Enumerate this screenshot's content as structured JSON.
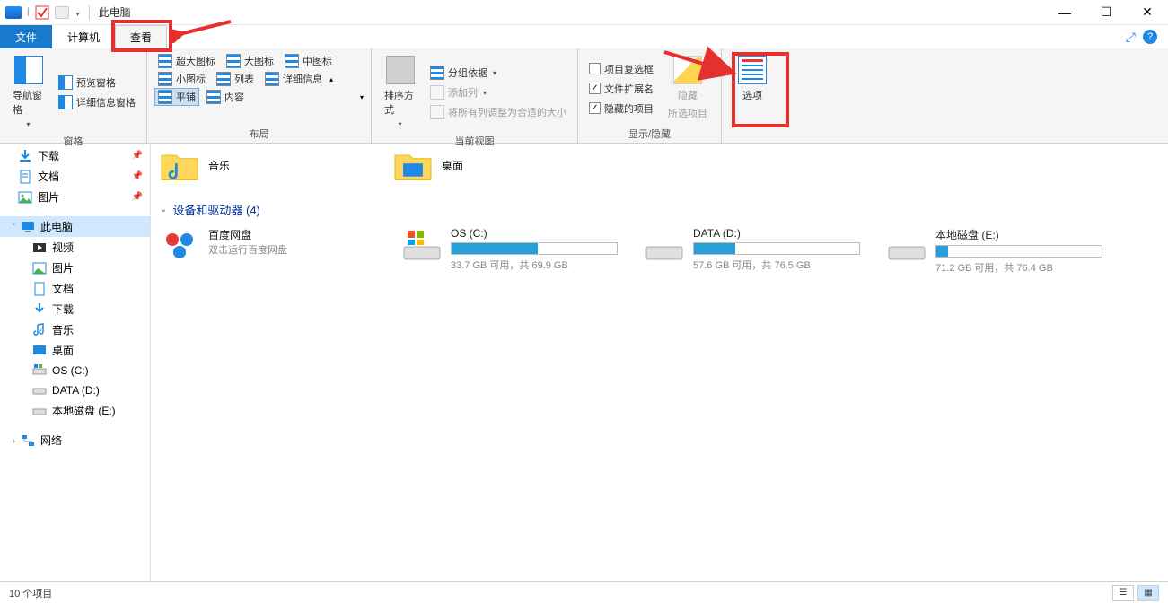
{
  "window": {
    "title": "此电脑"
  },
  "tabs": {
    "file": "文件",
    "computer": "计算机",
    "view": "查看"
  },
  "ribbon": {
    "panes": {
      "nav": "导航窗格",
      "preview": "预览窗格",
      "details": "详细信息窗格",
      "group_label": "窗格"
    },
    "layout": {
      "xl_icons": "超大图标",
      "l_icons": "大图标",
      "m_icons": "中图标",
      "s_icons": "小图标",
      "list": "列表",
      "details": "详细信息",
      "tiles": "平铺",
      "content": "内容",
      "group_label": "布局"
    },
    "currentview": {
      "sort": "排序方式",
      "groupby": "分组依据",
      "addcol": "添加列",
      "autosize": "将所有列调整为合适的大小",
      "group_label": "当前视图"
    },
    "showhide": {
      "checkboxes": "项目复选框",
      "extensions": "文件扩展名",
      "hidden": "隐藏的项目",
      "hide": "隐藏",
      "selected": "所选项目",
      "group_label": "显示/隐藏"
    },
    "options": {
      "label": "选项"
    }
  },
  "sidebar": {
    "downloads": "下载",
    "documents": "文档",
    "pictures": "图片",
    "thispc": "此电脑",
    "videos": "视频",
    "pictures2": "图片",
    "documents2": "文档",
    "downloads2": "下载",
    "music": "音乐",
    "desktop": "桌面",
    "osc": "OS (C:)",
    "datad": "DATA (D:)",
    "locale": "本地磁盘 (E:)",
    "network": "网络"
  },
  "content": {
    "folders": {
      "music": "音乐",
      "desktop": "桌面"
    },
    "section": {
      "devices": "设备和驱动器 (4)"
    },
    "baidu": {
      "title": "百度网盘",
      "sub": "双击运行百度网盘"
    },
    "drives": [
      {
        "name": "OS (C:)",
        "info": "33.7 GB 可用，共 69.9 GB",
        "fill": 52
      },
      {
        "name": "DATA (D:)",
        "info": "57.6 GB 可用，共 76.5 GB",
        "fill": 25
      },
      {
        "name": "本地磁盘 (E:)",
        "info": "71.2 GB 可用，共 76.4 GB",
        "fill": 7
      }
    ]
  },
  "status": {
    "items": "10 个项目"
  }
}
